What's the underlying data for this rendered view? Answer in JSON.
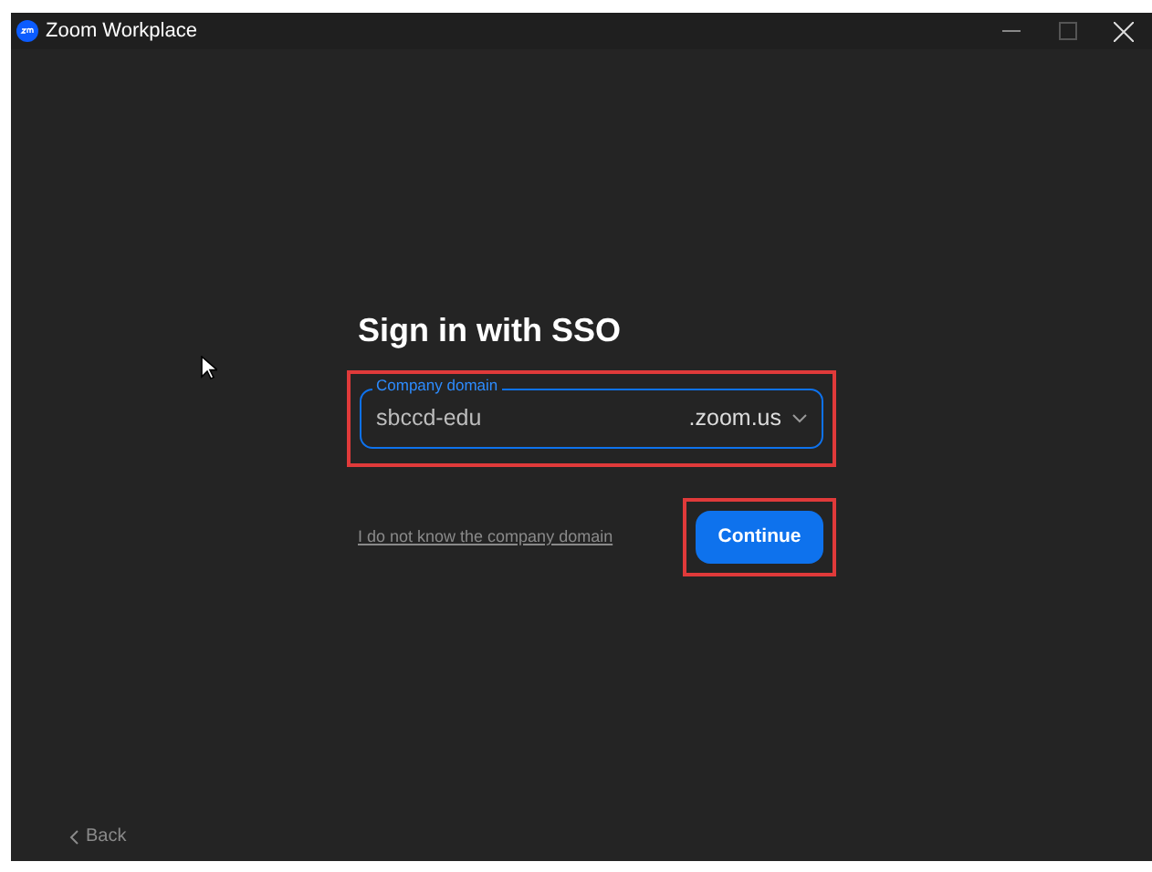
{
  "window": {
    "title": "Zoom Workplace"
  },
  "heading": "Sign in with SSO",
  "domain_field": {
    "label": "Company domain",
    "value": "sbccd-edu",
    "suffix": ".zoom.us"
  },
  "help_link": "I do not know the company domain",
  "continue_button": "Continue",
  "back_link": "Back"
}
